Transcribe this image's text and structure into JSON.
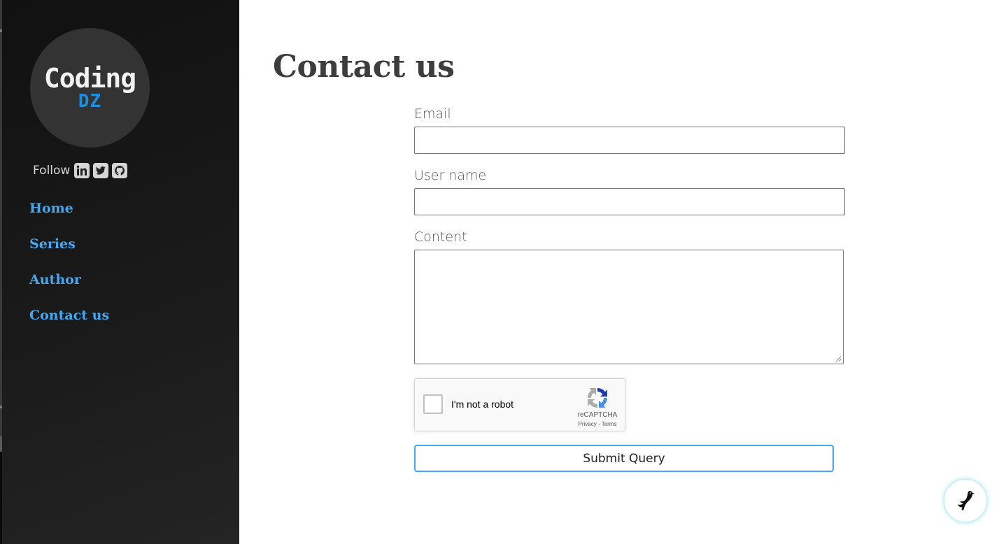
{
  "sidebar": {
    "logo": {
      "line1": "Coding",
      "line2": "DZ"
    },
    "follow_label": "Follow",
    "social_icons": [
      "linkedin-icon",
      "twitter-icon",
      "github-icon"
    ],
    "nav": [
      {
        "label": "Home"
      },
      {
        "label": "Series"
      },
      {
        "label": "Author"
      },
      {
        "label": "Contact us"
      }
    ]
  },
  "main": {
    "title": "Contact us",
    "form": {
      "email_label": "Email",
      "email_value": "",
      "username_label": "User name",
      "username_value": "",
      "content_label": "Content",
      "content_value": "",
      "recaptcha": {
        "label": "I'm not a robot",
        "brand": "reCAPTCHA",
        "links": "Privacy - Terms"
      },
      "submit_label": "Submit Query"
    }
  },
  "floating_button": {
    "icon": "bird-icon"
  },
  "colors": {
    "sidebar_bg": "#161616",
    "nav_link": "#45a8f0",
    "logo_accent": "#1e8fe0",
    "title": "#3d3d3d",
    "submit_border": "#45a8f0"
  }
}
